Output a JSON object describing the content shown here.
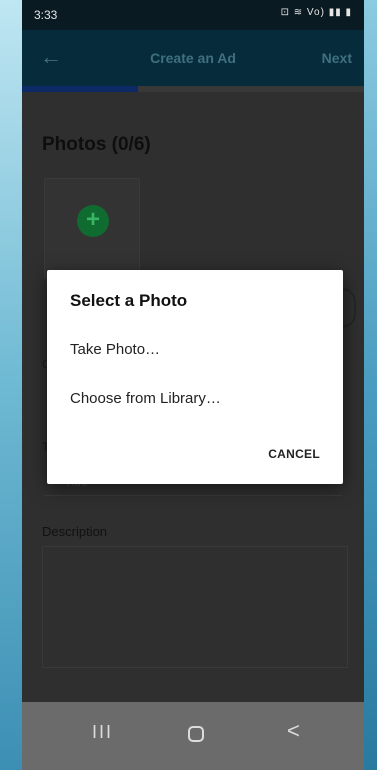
{
  "status_bar": {
    "time": "3:33",
    "icons_text": "⊡ ≋ Vo) ▮▮ ▮"
  },
  "header": {
    "back_icon": "←",
    "title": "Create an Ad",
    "next_label": "Next"
  },
  "progress": {
    "fraction": 0.34
  },
  "content": {
    "photos_title": "Photos (0/6)",
    "add_photo_icon": "+",
    "peek_c": "C",
    "peek_t": "T",
    "title_placeholder": "Title",
    "description_label": "Description"
  },
  "dialog": {
    "title": "Select a Photo",
    "options": [
      "Take Photo…",
      "Choose from Library…"
    ],
    "cancel_label": "CANCEL"
  },
  "nav_bar": {
    "recents_icon": "III",
    "back_icon": "<"
  },
  "colors": {
    "header_bg": "#062c3b",
    "progress_fill": "#0b2a66",
    "add_icon_green": "#0f6b2f",
    "dialog_bg": "#ffffff",
    "nav_bg": "#6b6b6b"
  }
}
